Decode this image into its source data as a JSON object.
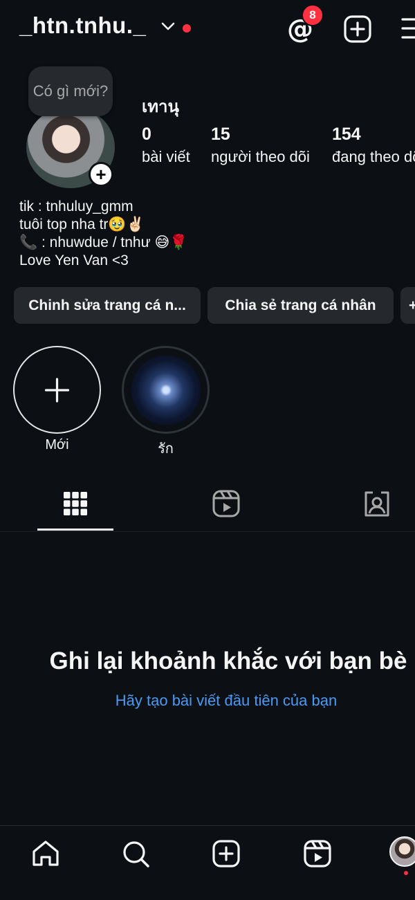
{
  "header": {
    "username": "_htn.tnhu._",
    "threads_badge": "8"
  },
  "profile": {
    "note": "Có gì mới?",
    "full_name": "เทานุ",
    "stats": [
      {
        "count": "0",
        "label": "bài viết"
      },
      {
        "count": "15",
        "label": "người theo dõi"
      },
      {
        "count": "154",
        "label": "đang theo dõi"
      }
    ],
    "bio": [
      "tik : tnhuluy_gmm",
      "tuôi top nha tr🥹✌🏻",
      "📞 : nhuwdue / tnhư 😅🌹",
      "Love Yen Van <3"
    ]
  },
  "actions": {
    "edit_label": "Chinh sửa trang cá n...",
    "share_label": "Chia sẻ trang cá nhân",
    "more_label": "+"
  },
  "highlights": [
    {
      "label": "Mới"
    },
    {
      "label": "รัก"
    }
  ],
  "empty_state": {
    "title": "Ghi lại khoảnh khắc với bạn bè",
    "link": "Hãy tạo bài viết đầu tiên của bạn"
  },
  "colors": {
    "background": "#0c1014",
    "accent_link": "#4a9af5",
    "notification": "#ff3040"
  },
  "icons": {
    "header": [
      "chevron-down-icon",
      "threads-icon",
      "plus-square-icon",
      "menu-icon"
    ],
    "tabs": [
      "grid-icon",
      "reels-icon",
      "tagged-icon"
    ],
    "nav": [
      "home-icon",
      "search-icon",
      "create-icon",
      "reels-icon",
      "profile-avatar"
    ]
  }
}
